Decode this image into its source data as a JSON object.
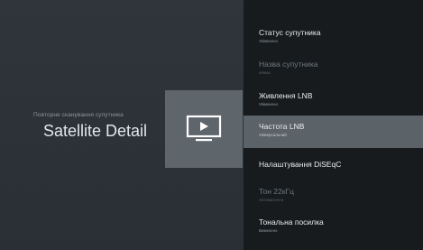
{
  "header": {
    "subtitle": "Повторне сканування супутника",
    "title": "Satellite Detail"
  },
  "menu": {
    "items": [
      {
        "label": "Статус супутника",
        "value": "Увімкнено",
        "state": "normal"
      },
      {
        "label": "Назва супутника",
        "value": "немає",
        "state": "disabled"
      },
      {
        "label": "Живлення LNB",
        "value": "Увімкнено",
        "state": "normal"
      },
      {
        "label": "Частота LNB",
        "value": "Універсальний",
        "state": "selected"
      },
      {
        "label": "Налаштування DiSEqC",
        "value": "",
        "state": "normal"
      },
      {
        "label": "Тон 22кГц",
        "value": "Автоматично",
        "state": "disabled"
      },
      {
        "label": "Тональна посилка",
        "value": "Вимкнено",
        "state": "normal"
      }
    ]
  },
  "icons": {
    "tile": "play-screen-icon"
  },
  "colors": {
    "background": "#2b3036",
    "menu_background": "#171b1e",
    "selected": "#5c6368",
    "tile": "#5e656b"
  }
}
